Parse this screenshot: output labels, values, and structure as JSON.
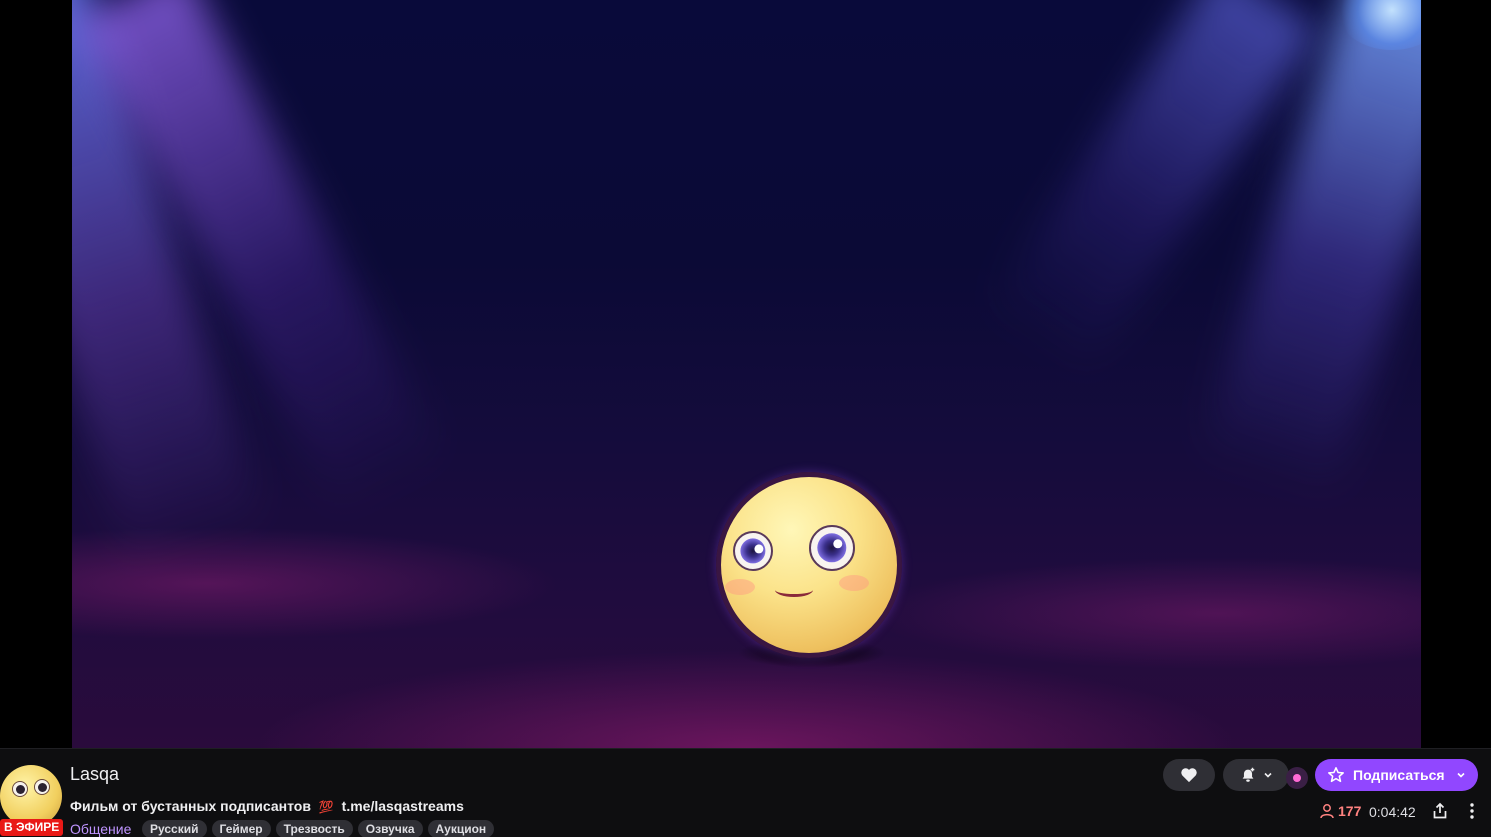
{
  "channel": {
    "name": "Lasqa",
    "live_label": "В ЭФИРЕ",
    "title": "Фильм от бустанных подписантов",
    "title_emoji": "💯",
    "title_link": "t.me/lasqastreams",
    "category": "Общение",
    "tags": [
      "Русский",
      "Геймер",
      "Трезвость",
      "Озвучка",
      "Аукцион"
    ]
  },
  "actions": {
    "follow_icon": "heart-icon",
    "notify_icon": "bell-plus-icon",
    "subscribe_label": "Подписаться"
  },
  "stats": {
    "viewers": "177",
    "uptime": "0:04:42"
  },
  "colors": {
    "accent": "#9147ff",
    "live_red": "#e91916",
    "category_purple": "#bf94ff",
    "viewer_red": "#ff8280"
  }
}
